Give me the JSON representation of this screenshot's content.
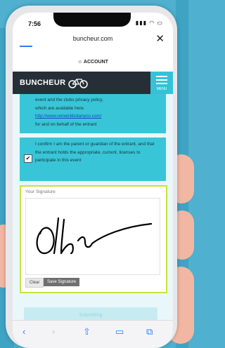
{
  "status_bar": {
    "time": "7:56",
    "icons": "▮▮▮ ◠ ▭"
  },
  "browser": {
    "url": "buncheur.com",
    "close": "✕"
  },
  "account": {
    "label": "☺ ACCOUNT"
  },
  "nav": {
    "logo_text": "BUNCHEUR",
    "logo_icon": "bicycle-icon",
    "menu_label": "MENU"
  },
  "consent1": {
    "line1": "event and the clubs privacy policy,",
    "line2": "which are available here",
    "link": "http://www.renwickbotanyco.com/",
    "line4": "for and on behalf of the entrant"
  },
  "consent2": {
    "checked": "✔",
    "text": "I confirm I am the parent or guardian of the entrant, and that the entrant holds the appropriate, current, licenses to participate in this event"
  },
  "signature": {
    "label": "Your Signature",
    "clear_label": "Clear",
    "save_label": "Save Signature",
    "stroke_color": "#000000"
  },
  "submit": {
    "label": "Submitting"
  },
  "bottom_bar": {
    "back": "‹",
    "forward": "›",
    "share": "⇧",
    "bookmarks": "▭",
    "tabs": "⧉"
  },
  "colors": {
    "accent": "#39c5d8",
    "nav_bg": "#262f37",
    "sig_border": "#c9e23a",
    "ios_blue": "#2d7ff9"
  }
}
